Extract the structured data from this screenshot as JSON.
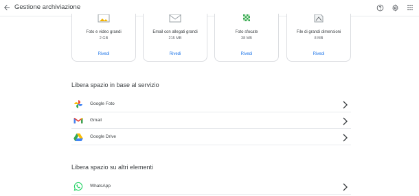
{
  "header": {
    "title": "Gestione archiviazione",
    "back_icon": "arrow-left-icon",
    "actions": [
      "help-icon",
      "settings-icon",
      "apps-grid-icon"
    ]
  },
  "cards": [
    {
      "name": "Foto e video grandi",
      "size": "2 GB",
      "action": "Rivedi",
      "icon": "photo-thumbnail-icon"
    },
    {
      "name": "Email con allegati grandi",
      "size": "215 MB",
      "action": "Rivedi",
      "icon": "email-attachment-icon"
    },
    {
      "name": "Foto sfocate",
      "size": "38 MB",
      "action": "Rivedi",
      "icon": "blurred-photo-icon"
    },
    {
      "name": "File di grandi dimensioni",
      "size": "8 MB",
      "action": "Rivedi",
      "icon": "large-file-icon"
    }
  ],
  "service_section": {
    "title": "Libera spazio in base al servizio",
    "items": [
      {
        "label": "Google Foto",
        "icon": "google-photos-icon"
      },
      {
        "label": "Gmail",
        "icon": "gmail-icon"
      },
      {
        "label": "Google Drive",
        "icon": "google-drive-icon"
      }
    ]
  },
  "other_section": {
    "title": "Libera spazio su altri elementi",
    "items": [
      {
        "label": "WhatsApp",
        "icon": "whatsapp-icon"
      }
    ]
  },
  "colors": {
    "link": "#1a73e8",
    "text": "#3c4043",
    "divider": "#e8eaed"
  }
}
